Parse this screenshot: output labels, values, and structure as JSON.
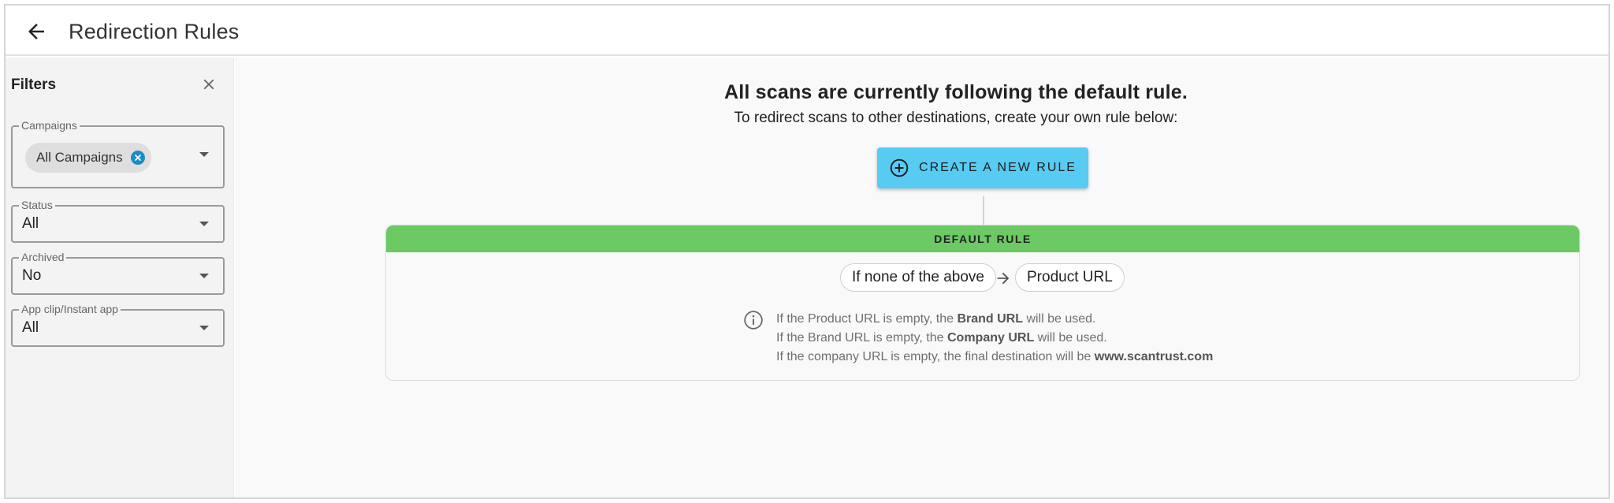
{
  "header": {
    "title": "Redirection Rules",
    "back_icon": "arrow-left-icon"
  },
  "sidebar": {
    "title": "Filters",
    "close_icon": "close-icon",
    "filters": {
      "campaigns": {
        "label": "Campaigns",
        "chip": "All Campaigns"
      },
      "status": {
        "label": "Status",
        "value": "All"
      },
      "archived": {
        "label": "Archived",
        "value": "No"
      },
      "app_clip": {
        "label": "App clip/Instant app",
        "value": "All"
      }
    }
  },
  "main": {
    "headline": "All scans are currently following the default rule.",
    "subline": "To redirect scans to other destinations, create your own rule below:",
    "create_button": "CREATE A NEW RULE",
    "default_rule": {
      "band_label": "DEFAULT RULE",
      "condition": "If none of the above",
      "destination": "Product URL",
      "info": {
        "line1_pre": "If the Product URL is empty, the ",
        "line1_bold": "Brand URL",
        "line1_post": " will be used.",
        "line2_pre": "If the Brand URL is empty, the ",
        "line2_bold": "Company URL",
        "line2_post": " will be used.",
        "line3_pre": "If the company URL is empty, the final destination will be ",
        "line3_bold": "www.scantrust.com"
      }
    }
  },
  "colors": {
    "accent_button": "#57cbf2",
    "rule_band": "#6cc964",
    "chip_close": "#1a8dc4"
  }
}
